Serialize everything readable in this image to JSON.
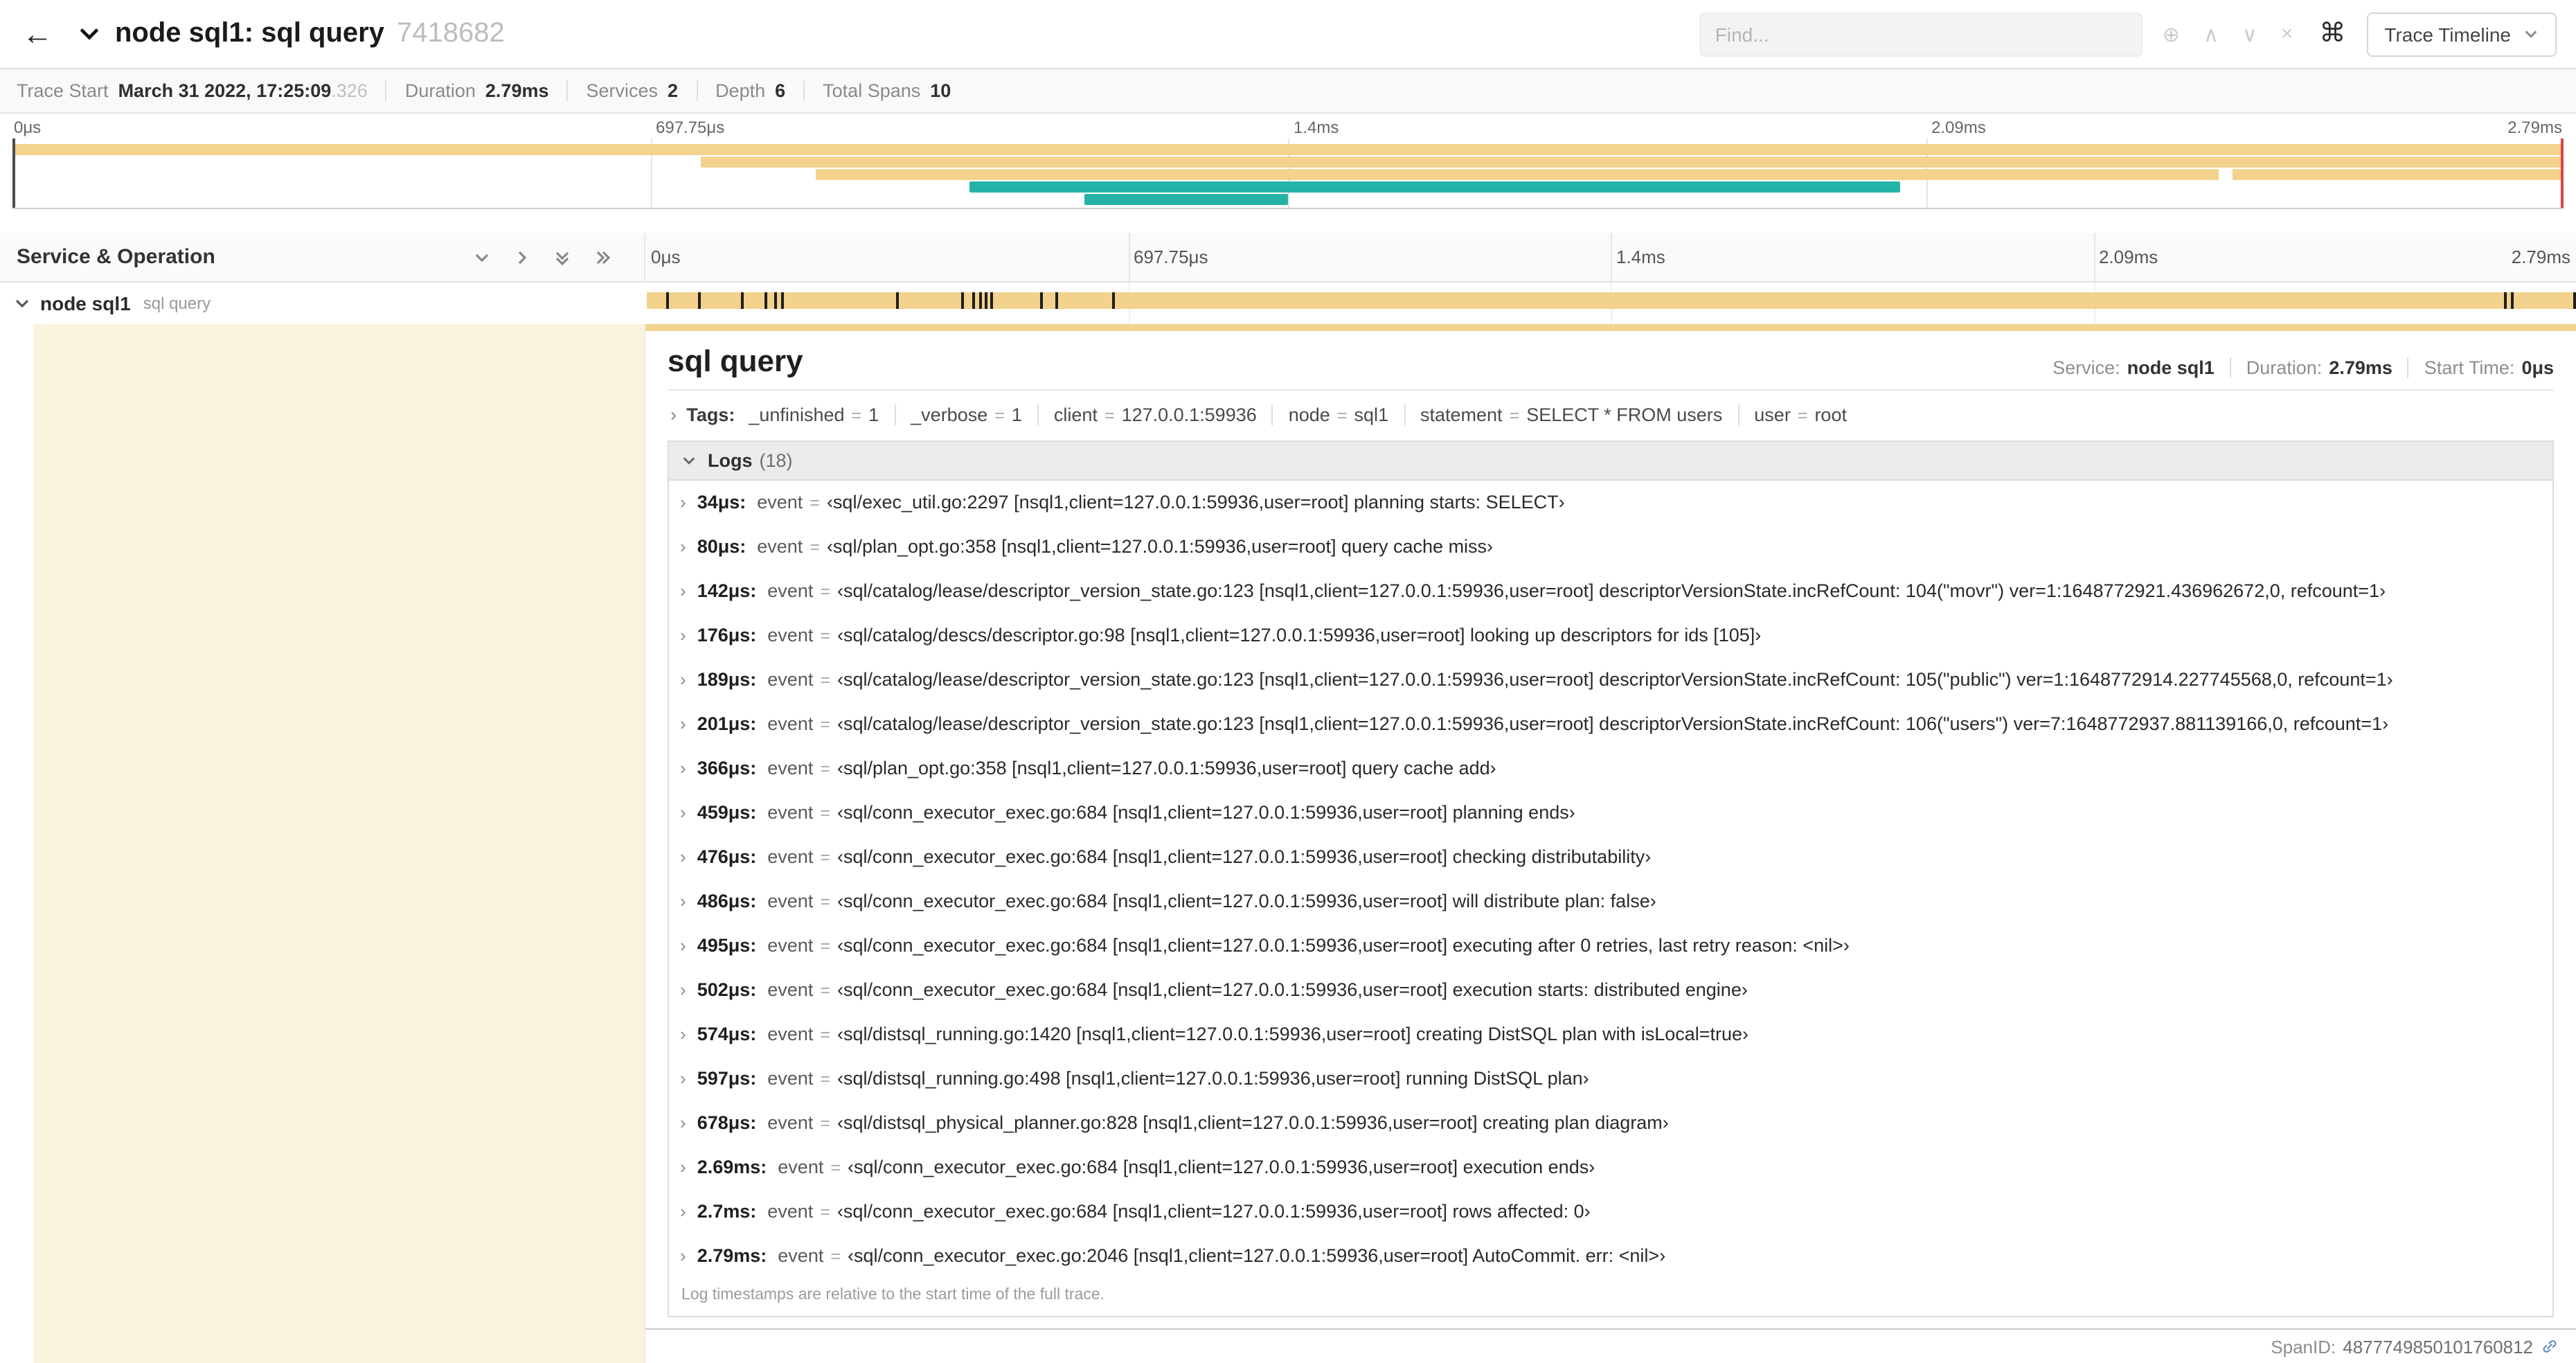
{
  "colors": {
    "tan": "#f2d28d",
    "teal": "#26b3a7",
    "cream": "#fbf4dd",
    "scrubber_red": "#e04343"
  },
  "glyphs": {
    "eq": "="
  },
  "icons": {
    "back": "←",
    "locate": "⊕",
    "prev": "∧",
    "next": "∨",
    "clear": "×",
    "command": "⌘",
    "twistie": "›"
  },
  "header": {
    "title": "node sql1: sql query",
    "trace_id": "7418682",
    "find_placeholder": "Find...",
    "trace_timeline_label": "Trace Timeline"
  },
  "summary": [
    {
      "label": "Trace Start",
      "value": "March 31 2022, 17:25:09",
      "muted": ".326"
    },
    {
      "label": "Duration",
      "value": "2.79ms",
      "muted": ""
    },
    {
      "label": "Services",
      "value": "2",
      "muted": ""
    },
    {
      "label": "Depth",
      "value": "6",
      "muted": ""
    },
    {
      "label": "Total Spans",
      "value": "10",
      "muted": ""
    }
  ],
  "minimap": {
    "ticks": [
      "0μs",
      "697.75μs",
      "1.4ms",
      "2.09ms",
      "2.79ms"
    ],
    "spans": [
      {
        "row": 0,
        "start": 0,
        "end": 100,
        "color": "tan"
      },
      {
        "row": 1,
        "start": 27,
        "end": 100,
        "color": "tan"
      },
      {
        "row": 2,
        "start": 31.5,
        "end": 86.5,
        "color": "tan"
      },
      {
        "row": 2,
        "start": 87,
        "end": 100,
        "color": "tan"
      },
      {
        "row": 3,
        "start": 37.5,
        "end": 74,
        "color": "teal"
      },
      {
        "row": 4,
        "start": 42,
        "end": 50,
        "color": "teal"
      }
    ]
  },
  "timeline": {
    "left_header": "Service & Operation",
    "ticks": [
      "0μs",
      "697.75μs",
      "1.4ms",
      "2.09ms",
      "2.79ms"
    ],
    "row": {
      "service": "node sql1",
      "operation": "sql query"
    },
    "event_ticks_pct": [
      1.2,
      2.9,
      5.1,
      6.3,
      6.8,
      7.2,
      13.1,
      16.5,
      17.1,
      17.4,
      17.7,
      18.0,
      20.6,
      21.4,
      24.3,
      96.4,
      96.8,
      100
    ]
  },
  "detail": {
    "title": "sql query",
    "meta": [
      {
        "label": "Service:",
        "value": "node sql1"
      },
      {
        "label": "Duration:",
        "value": "2.79ms"
      },
      {
        "label": "Start Time:",
        "value": "0μs"
      }
    ],
    "tags_label": "Tags:",
    "tags": [
      {
        "key": "_unfinished",
        "value": "1"
      },
      {
        "key": "_verbose",
        "value": "1"
      },
      {
        "key": "client",
        "value": "127.0.0.1:59936"
      },
      {
        "key": "node",
        "value": "sql1"
      },
      {
        "key": "statement",
        "value": "SELECT * FROM users"
      },
      {
        "key": "user",
        "value": "root"
      }
    ],
    "logs_title": "Logs",
    "logs_count": "(18)",
    "logs": [
      {
        "time": "34μs:",
        "key": "event",
        "value": "‹sql/exec_util.go:2297 [nsql1,client=127.0.0.1:59936,user=root] planning starts: SELECT›"
      },
      {
        "time": "80μs:",
        "key": "event",
        "value": "‹sql/plan_opt.go:358 [nsql1,client=127.0.0.1:59936,user=root] query cache miss›"
      },
      {
        "time": "142μs:",
        "key": "event",
        "value": "‹sql/catalog/lease/descriptor_version_state.go:123 [nsql1,client=127.0.0.1:59936,user=root] descriptorVersionState.incRefCount: 104(\"movr\") ver=1:1648772921.436962672,0, refcount=1›"
      },
      {
        "time": "176μs:",
        "key": "event",
        "value": "‹sql/catalog/descs/descriptor.go:98 [nsql1,client=127.0.0.1:59936,user=root] looking up descriptors for ids [105]›"
      },
      {
        "time": "189μs:",
        "key": "event",
        "value": "‹sql/catalog/lease/descriptor_version_state.go:123 [nsql1,client=127.0.0.1:59936,user=root] descriptorVersionState.incRefCount: 105(\"public\") ver=1:1648772914.227745568,0, refcount=1›"
      },
      {
        "time": "201μs:",
        "key": "event",
        "value": "‹sql/catalog/lease/descriptor_version_state.go:123 [nsql1,client=127.0.0.1:59936,user=root] descriptorVersionState.incRefCount: 106(\"users\") ver=7:1648772937.881139166,0, refcount=1›"
      },
      {
        "time": "366μs:",
        "key": "event",
        "value": "‹sql/plan_opt.go:358 [nsql1,client=127.0.0.1:59936,user=root] query cache add›"
      },
      {
        "time": "459μs:",
        "key": "event",
        "value": "‹sql/conn_executor_exec.go:684 [nsql1,client=127.0.0.1:59936,user=root] planning ends›"
      },
      {
        "time": "476μs:",
        "key": "event",
        "value": "‹sql/conn_executor_exec.go:684 [nsql1,client=127.0.0.1:59936,user=root] checking distributability›"
      },
      {
        "time": "486μs:",
        "key": "event",
        "value": "‹sql/conn_executor_exec.go:684 [nsql1,client=127.0.0.1:59936,user=root] will distribute plan: false›"
      },
      {
        "time": "495μs:",
        "key": "event",
        "value": "‹sql/conn_executor_exec.go:684 [nsql1,client=127.0.0.1:59936,user=root] executing after 0 retries, last retry reason: <nil>›"
      },
      {
        "time": "502μs:",
        "key": "event",
        "value": "‹sql/conn_executor_exec.go:684 [nsql1,client=127.0.0.1:59936,user=root] execution starts: distributed engine›"
      },
      {
        "time": "574μs:",
        "key": "event",
        "value": "‹sql/distsql_running.go:1420 [nsql1,client=127.0.0.1:59936,user=root] creating DistSQL plan with isLocal=true›"
      },
      {
        "time": "597μs:",
        "key": "event",
        "value": "‹sql/distsql_running.go:498 [nsql1,client=127.0.0.1:59936,user=root] running DistSQL plan›"
      },
      {
        "time": "678μs:",
        "key": "event",
        "value": "‹sql/distsql_physical_planner.go:828 [nsql1,client=127.0.0.1:59936,user=root] creating plan diagram›"
      },
      {
        "time": "2.69ms:",
        "key": "event",
        "value": "‹sql/conn_executor_exec.go:684 [nsql1,client=127.0.0.1:59936,user=root] execution ends›"
      },
      {
        "time": "2.7ms:",
        "key": "event",
        "value": "‹sql/conn_executor_exec.go:684 [nsql1,client=127.0.0.1:59936,user=root] rows affected: 0›"
      },
      {
        "time": "2.79ms:",
        "key": "event",
        "value": "‹sql/conn_executor_exec.go:2046 [nsql1,client=127.0.0.1:59936,user=root] AutoCommit. err: <nil>›"
      }
    ],
    "logs_note": "Log timestamps are relative to the start time of the full trace.",
    "footer": {
      "span_id_label": "SpanID:",
      "span_id": "4877749850101760812"
    }
  }
}
